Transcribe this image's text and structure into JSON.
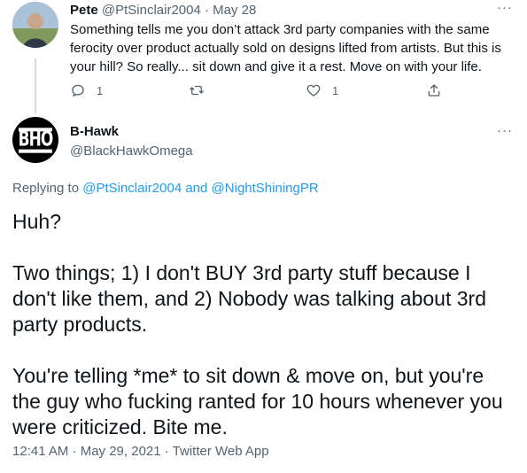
{
  "reply_tweet": {
    "name": "Pete",
    "handle": "@PtSinclair2004",
    "separator": "·",
    "date": "May 28",
    "more": "···",
    "text": "Something tells me you don’t attack 3rd party companies with the same ferocity over product actually sold on designs lifted from artists. But this is your hill? So really... sit down and give it a rest. Move on with your life.",
    "actions": {
      "reply_icon": "reply-bubble-icon",
      "reply_count": "1",
      "retweet_icon": "retweet-icon",
      "like_icon": "heart-icon",
      "like_count": "1",
      "share_icon": "share-icon"
    }
  },
  "main_tweet": {
    "name": "B-Hawk",
    "handle": "@BlackHawkOmega",
    "avatar_text": "BHO",
    "more": "···",
    "replying_prefix": "Replying to",
    "replying_user1": "@PtSinclair2004",
    "replying_and": "and",
    "replying_user2": "@NightShiningPR",
    "paragraphs": [
      "Huh?",
      "Two things; 1) I don't BUY 3rd party stuff because I don't like them, and 2) Nobody was talking about 3rd party products.",
      "You're telling *me* to sit down & move on, but you're the guy who fucking ranted for 10 hours whenever you were criticized. Bite me."
    ],
    "meta": "12:41 AM · May 29, 2021 · Twitter Web App"
  },
  "colors": {
    "text_primary": "#0f1419",
    "text_secondary": "#536471",
    "link": "#1d9bf0",
    "thread_line": "#cfd9de"
  }
}
